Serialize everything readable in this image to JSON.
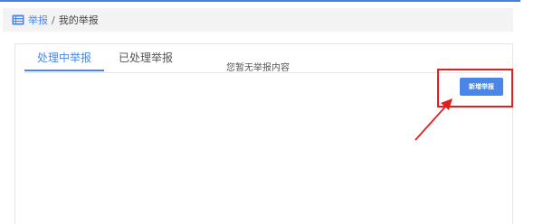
{
  "breadcrumb": {
    "icon": "list-icon",
    "parent": "举报",
    "separator": "/",
    "current": "我的举报"
  },
  "tabs": [
    {
      "label": "处理中举报",
      "active": true
    },
    {
      "label": "已处理举报",
      "active": false
    }
  ],
  "empty_message": "您暂无举报内容",
  "add_button_label": "新增举报",
  "annotation": {
    "color": "#e02020"
  },
  "colors": {
    "accent": "#4a86e8",
    "annotation": "#e02020"
  }
}
